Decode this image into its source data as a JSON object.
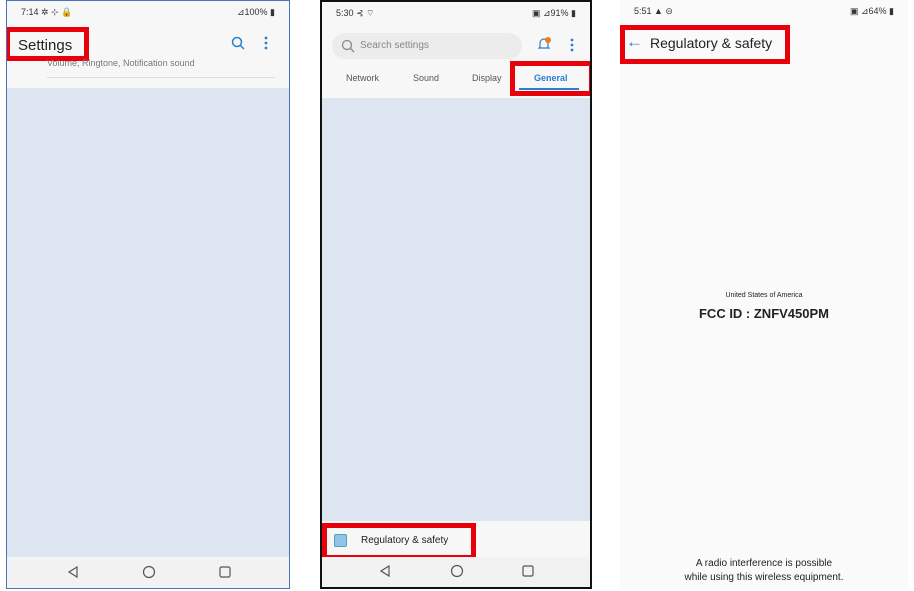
{
  "phone1": {
    "status": {
      "time": "7:14 ✲ ⊹ 🔒",
      "right": "⊿100% ▮"
    },
    "title": "Settings",
    "partial_row": "Volume, Ringtone, Notification sound",
    "search_icon": "search-icon",
    "more_icon": "more-vert-icon"
  },
  "phone2": {
    "status": {
      "time": "5:30 ⊰ ⌔",
      "right": "▣ ⊿91% ▮"
    },
    "search_placeholder": "Search settings",
    "tabs": [
      "Network",
      "Sound",
      "Display",
      "General"
    ],
    "active_tab": "General",
    "bottom_item": "Regulatory & safety"
  },
  "phone3": {
    "status": {
      "time": "5:51 ▲ ⊝",
      "right": "▣ ⊿64% ▮"
    },
    "title": "Regulatory & safety",
    "country": "United States of America",
    "fcc_id": "FCC ID : ZNFV450PM",
    "notice_line1": "A radio interference is possible",
    "notice_line2": "while using this wireless equipment."
  },
  "colors": {
    "highlight": "#e8000b",
    "accent": "#2a7fd0",
    "blank_area": "#dde6f0"
  }
}
